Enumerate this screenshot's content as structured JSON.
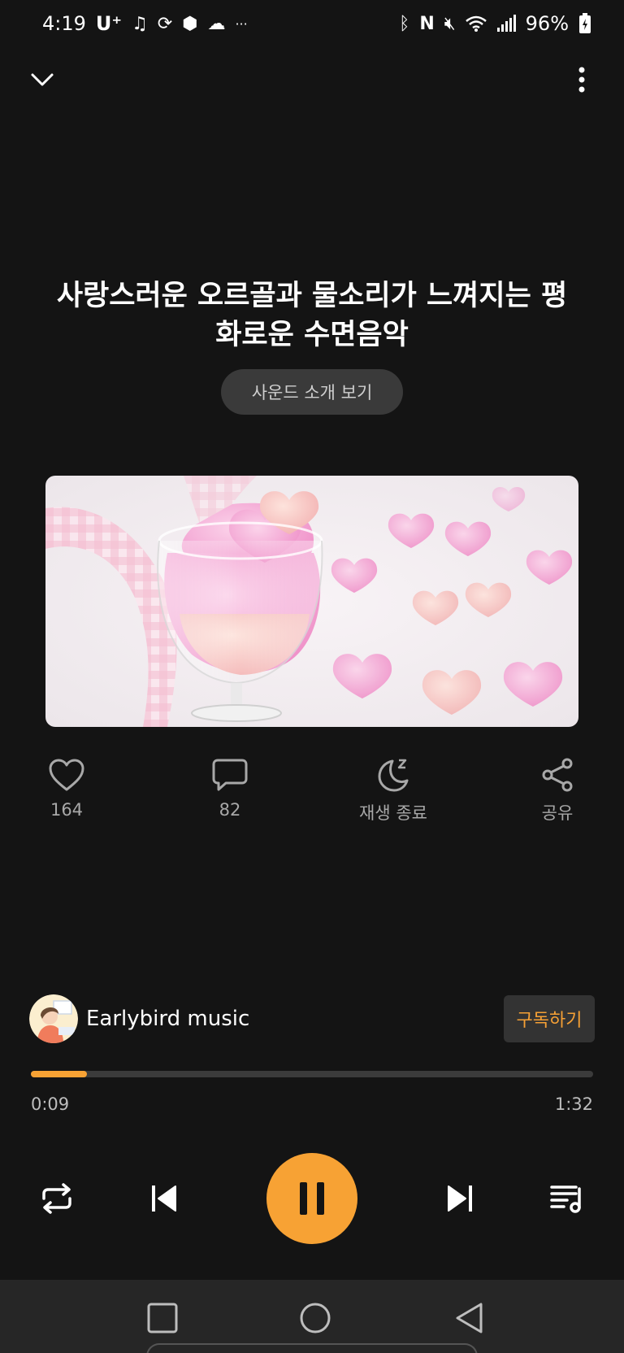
{
  "status_bar": {
    "time": "4:19",
    "carrier": "U⁺",
    "battery": "96%",
    "left_icons": [
      "music-note-icon",
      "sync-icon",
      "cube-icon",
      "cloud-icon",
      "more-dots-icon"
    ],
    "right_icons": [
      "bluetooth-icon",
      "nfc-icon",
      "mute-icon",
      "wifi-icon",
      "signal-icon",
      "battery-icon"
    ]
  },
  "track": {
    "title": "사랑스러운 오르골과 물소리가 느껴지는 평화로운 수면음악",
    "intro_button": "사운드 소개 보기"
  },
  "actions": {
    "like": {
      "label": "164",
      "icon": "heart-icon"
    },
    "comment": {
      "label": "82",
      "icon": "comment-icon"
    },
    "sleep_timer": {
      "label": "재생 종료",
      "icon": "moon-icon"
    },
    "share": {
      "label": "공유",
      "icon": "share-icon"
    }
  },
  "channel": {
    "name": "Earlybird music",
    "subscribe_label": "구독하기"
  },
  "playback": {
    "current_time": "0:09",
    "total_time": "1:32",
    "progress_fraction": 0.1,
    "state": "playing"
  },
  "colors": {
    "accent": "#f7a234",
    "background": "#141414",
    "nav_bar": "#262626"
  }
}
